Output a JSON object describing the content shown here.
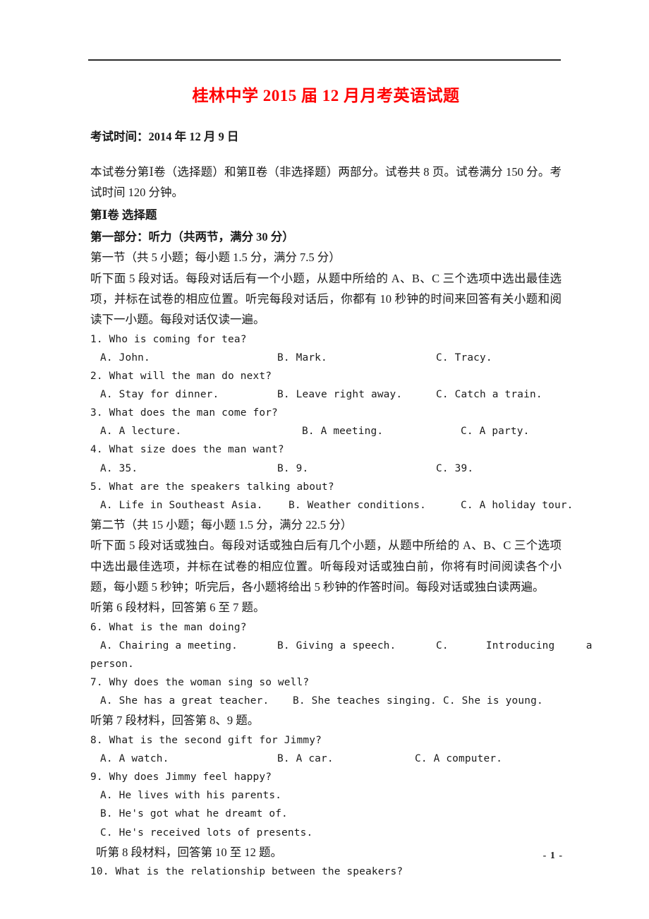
{
  "document": {
    "title": "桂林中学 2015 届 12 月月考英语试题",
    "title_color": "#ff0000",
    "exam_time_line": "考试时间：2014 年 12 月 9 日",
    "intro_paragraph": "本试卷分第Ⅰ卷（选择题）和第Ⅱ卷（非选择题）两部分。试卷共 8 页。试卷满分 150 分。考试时间 120 分钟。",
    "page_number": "- 1 -"
  },
  "sections": {
    "volume_one": "第Ⅰ卷 选择题",
    "part_one": "第一部分：听力（共两节，满分 30 分）",
    "sub_one_head": "第一节（共 5 小题；每小题 1.5 分，满分 7.5 分）",
    "sub_one_instructions": "听下面 5 段对话。每段对话后有一个小题，从题中所给的 A、B、C 三个选项中选出最佳选项，并标在试卷的相应位置。听完每段对话后，你都有 10 秒钟的时间来回答有关小题和阅读下一小题。每段对话仅读一遍。",
    "sub_two_head": "第二节（共 15 小题；每小题 1.5 分，满分 22.5 分）",
    "sub_two_instructions": "听下面 5 段对话或独白。每段对话或独白后有几个小题，从题中所给的 A、B、C 三个选项中选出最佳选项，并标在试卷的相应位置。听每段对话或独白前，你将有时间阅读各个小题，每小题 5 秒钟；听完后，各小题将给出 5 秒钟的作答时间。每段对话或独白读两遍。",
    "material_6": "听第 6 段材料，回答第 6 至 7 题。",
    "material_7": "听第 7 段材料，回答第 8、9 题。",
    "material_8": "听第 8 段材料，回答第 10 至 12 题。"
  },
  "questions": {
    "q1": {
      "stem": "1. Who is coming for tea?",
      "a": "A. John.",
      "b": "B. Mark.",
      "c": "C. Tracy."
    },
    "q2": {
      "stem": "2. What will the man do next?",
      "a": "A. Stay for dinner.",
      "b": "B. Leave right away.",
      "c": "C. Catch a train."
    },
    "q3": {
      "stem": "3. What does the man come for?",
      "a": "A. A lecture.",
      "b": "B. A meeting.",
      "c": "C. A party."
    },
    "q4": {
      "stem": "4. What size does the man want?",
      "a": "A. 35.",
      "b": "B. 9.",
      "c": "C. 39."
    },
    "q5": {
      "stem": "5. What are the speakers talking about?",
      "a": "A. Life in Southeast Asia.",
      "b": "B. Weather conditions.",
      "c": "C. A holiday tour."
    },
    "q6": {
      "stem": "6. What is the man doing?",
      "a": "A. Chairing a meeting.",
      "b": "B. Giving a speech.",
      "c": "C.      Introducing     a",
      "c_cont": "person."
    },
    "q7": {
      "stem": "7. Why does the woman sing so well?",
      "a": "A. She has a great teacher.",
      "b": "B. She teaches singing.",
      "c": "C. She is young."
    },
    "q8": {
      "stem": "8. What is the second gift for Jimmy?",
      "a": "A. A watch.",
      "b": "B. A car.",
      "c": "C. A computer."
    },
    "q9": {
      "stem": "9. Why does Jimmy feel happy?",
      "a": "A. He lives with his parents.",
      "b": "B. He's got what he dreamt of.",
      "c": "C. He's received lots of presents."
    },
    "q10": {
      "stem": "10. What is the relationship between the speakers?"
    }
  }
}
